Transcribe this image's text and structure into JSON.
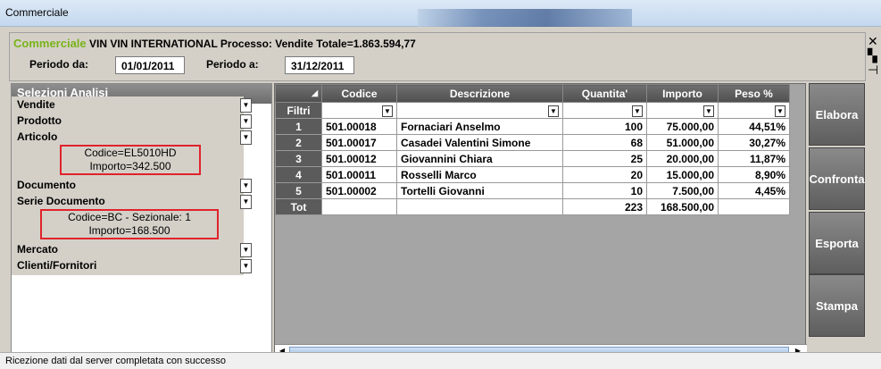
{
  "window": {
    "title": "Commerciale"
  },
  "header": {
    "brand": "Commerciale",
    "info": "VIN VIN INTERNATIONAL  Processo: Vendite Totale=1.863.594,77",
    "periodo_da_label": "Periodo da:",
    "periodo_da": "01/01/2011",
    "periodo_a_label": "Periodo a:",
    "periodo_a": "31/12/2011"
  },
  "left": {
    "title": "Selezioni Analisi",
    "items": [
      "Vendite",
      "Prodotto",
      "Articolo",
      "Documento",
      "Serie Documento",
      "Mercato",
      "Clienti/Fornitori"
    ],
    "sel1": {
      "line1": "Codice=EL5010HD",
      "line2": "Importo=342.500"
    },
    "sel2": {
      "line1": "Codice=BC - Sezionale: 1",
      "line2": "Importo=168.500"
    }
  },
  "grid": {
    "columns": [
      "Codice",
      "Descrizione",
      "Quantita'",
      "Importo",
      "Peso %"
    ],
    "filter_label": "Filtri",
    "rows": [
      {
        "n": "1",
        "codice": "501.00018",
        "descrizione": "Fornaciari Anselmo",
        "quantita": "100",
        "importo": "75.000,00",
        "peso": "44,51%"
      },
      {
        "n": "2",
        "codice": "501.00017",
        "descrizione": "Casadei Valentini Simone",
        "quantita": "68",
        "importo": "51.000,00",
        "peso": "30,27%"
      },
      {
        "n": "3",
        "codice": "501.00012",
        "descrizione": "Giovannini Chiara",
        "quantita": "25",
        "importo": "20.000,00",
        "peso": "11,87%"
      },
      {
        "n": "4",
        "codice": "501.00011",
        "descrizione": "Rosselli Marco",
        "quantita": "20",
        "importo": "15.000,00",
        "peso": "8,90%"
      },
      {
        "n": "5",
        "codice": "501.00002",
        "descrizione": "Tortelli Giovanni",
        "quantita": "10",
        "importo": "7.500,00",
        "peso": "4,45%"
      }
    ],
    "total": {
      "label": "Tot",
      "quantita": "223",
      "importo": "168.500,00"
    }
  },
  "buttons": {
    "elabora": "Elabora",
    "confronta": "Confronta",
    "esporta": "Esporta",
    "stampa": "Stampa"
  },
  "status": "Ricezione dati dal server completata con successo"
}
